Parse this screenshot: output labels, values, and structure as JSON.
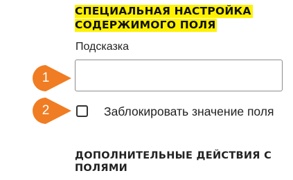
{
  "section_title_lines": [
    "СПЕЦИАЛЬНАЯ НАСТРОЙКА",
    "СОДЕРЖИМОГО ПОЛЯ"
  ],
  "hint_field": {
    "label": "Подсказка",
    "value": "",
    "placeholder": ""
  },
  "lock_checkbox": {
    "label": "Заблокировать значение поля",
    "checked": false
  },
  "additional_section_title": "ДОПОЛНИТЕЛЬНЫЕ ДЕЙСТВИЯ С ПОЛЯМИ",
  "callouts": [
    {
      "number": "1",
      "target": "hint_field"
    },
    {
      "number": "2",
      "target": "lock_checkbox"
    }
  ],
  "colors": {
    "highlight": "#fff200",
    "callout": "#f07d23",
    "text": "#222222",
    "input_border": "#8c8c8c"
  }
}
